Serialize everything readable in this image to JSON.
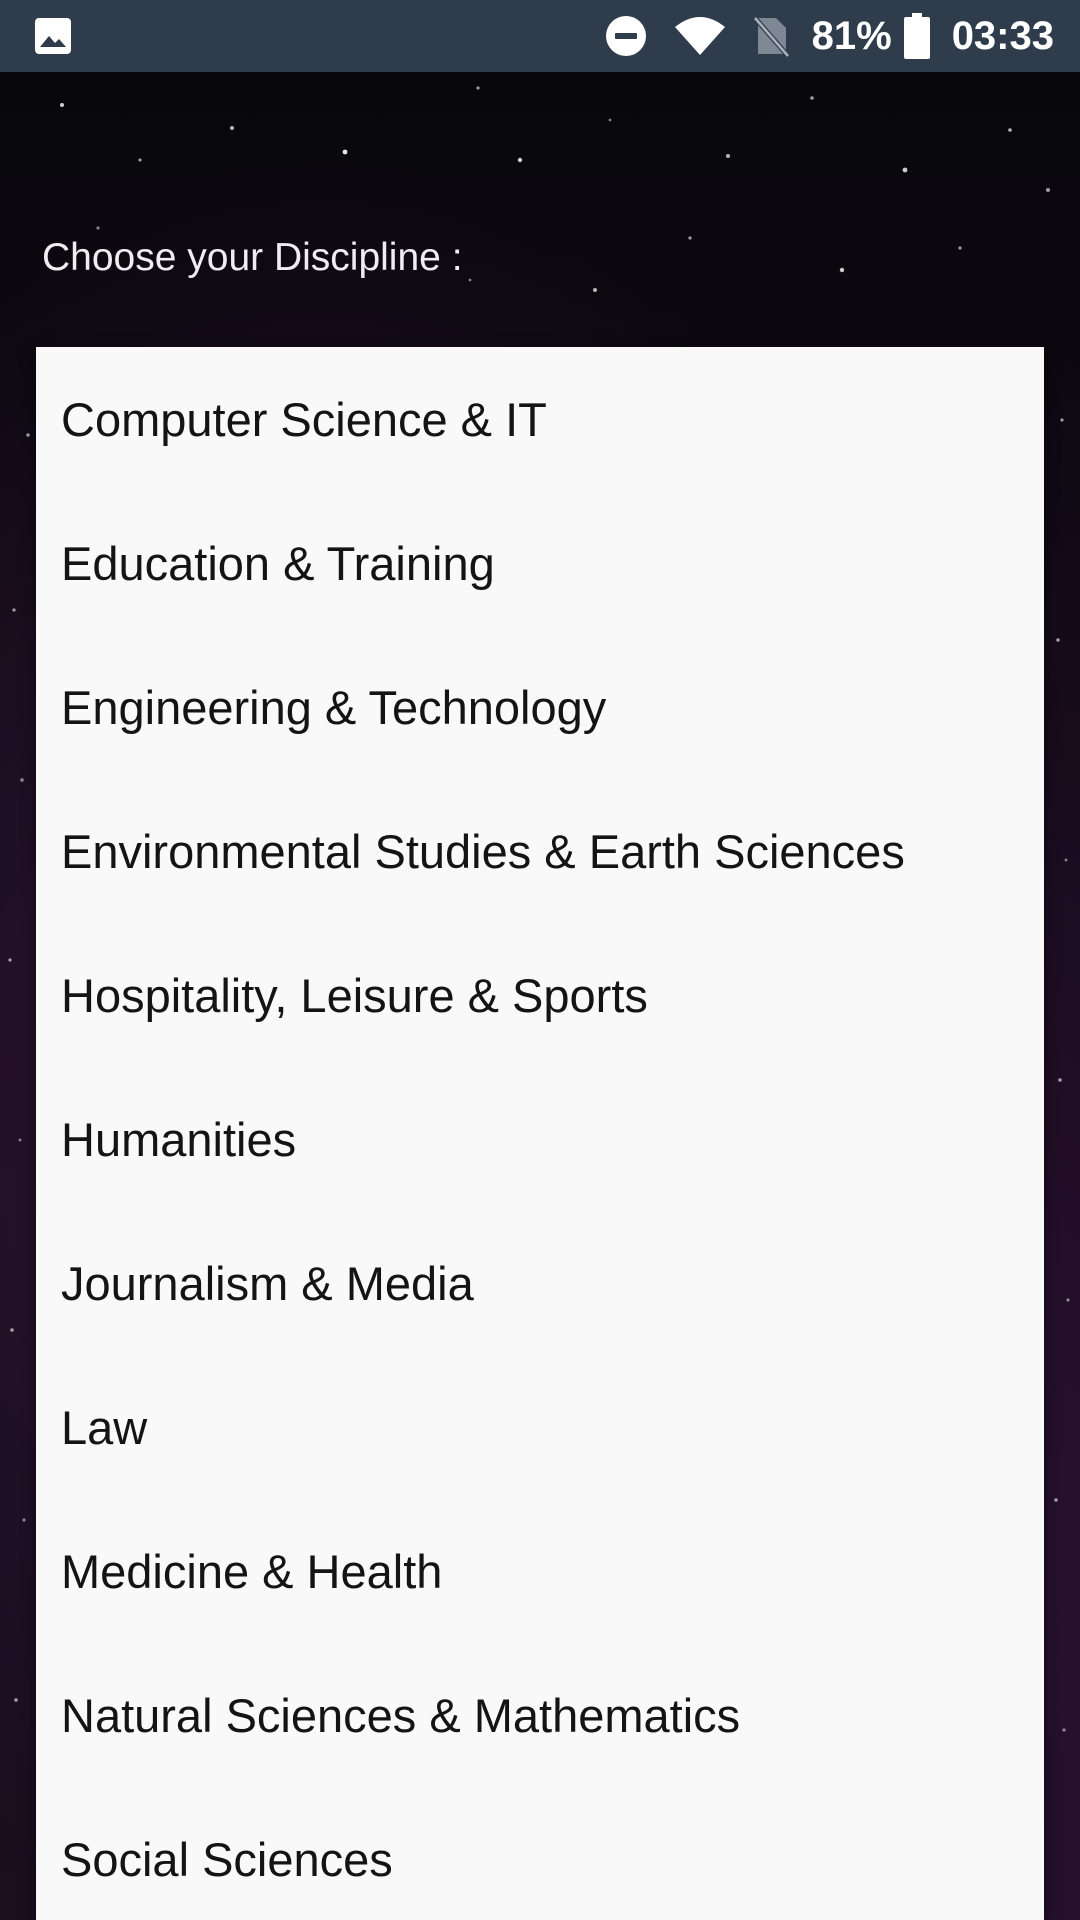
{
  "status_bar": {
    "gallery_icon": "image-icon",
    "dnd_icon": "do-not-disturb-icon",
    "wifi_icon": "wifi-icon",
    "sim_icon": "no-sim-icon",
    "battery_percent": "81%",
    "battery_icon": "battery-icon",
    "time": "03:33",
    "background_color": "#2f3c4c"
  },
  "prompt": "Choose your Discipline :",
  "options": [
    "Computer Science & IT",
    "Education & Training",
    "Engineering & Technology",
    "Environmental Studies & Earth Sciences",
    "Hospitality, Leisure & Sports",
    "Humanities",
    "Journalism & Media",
    "Law",
    "Medicine & Health",
    "Natural Sciences & Mathematics",
    "Social Sciences"
  ],
  "colors": {
    "dropdown_background": "#f9f9f9",
    "option_text": "#141414"
  }
}
